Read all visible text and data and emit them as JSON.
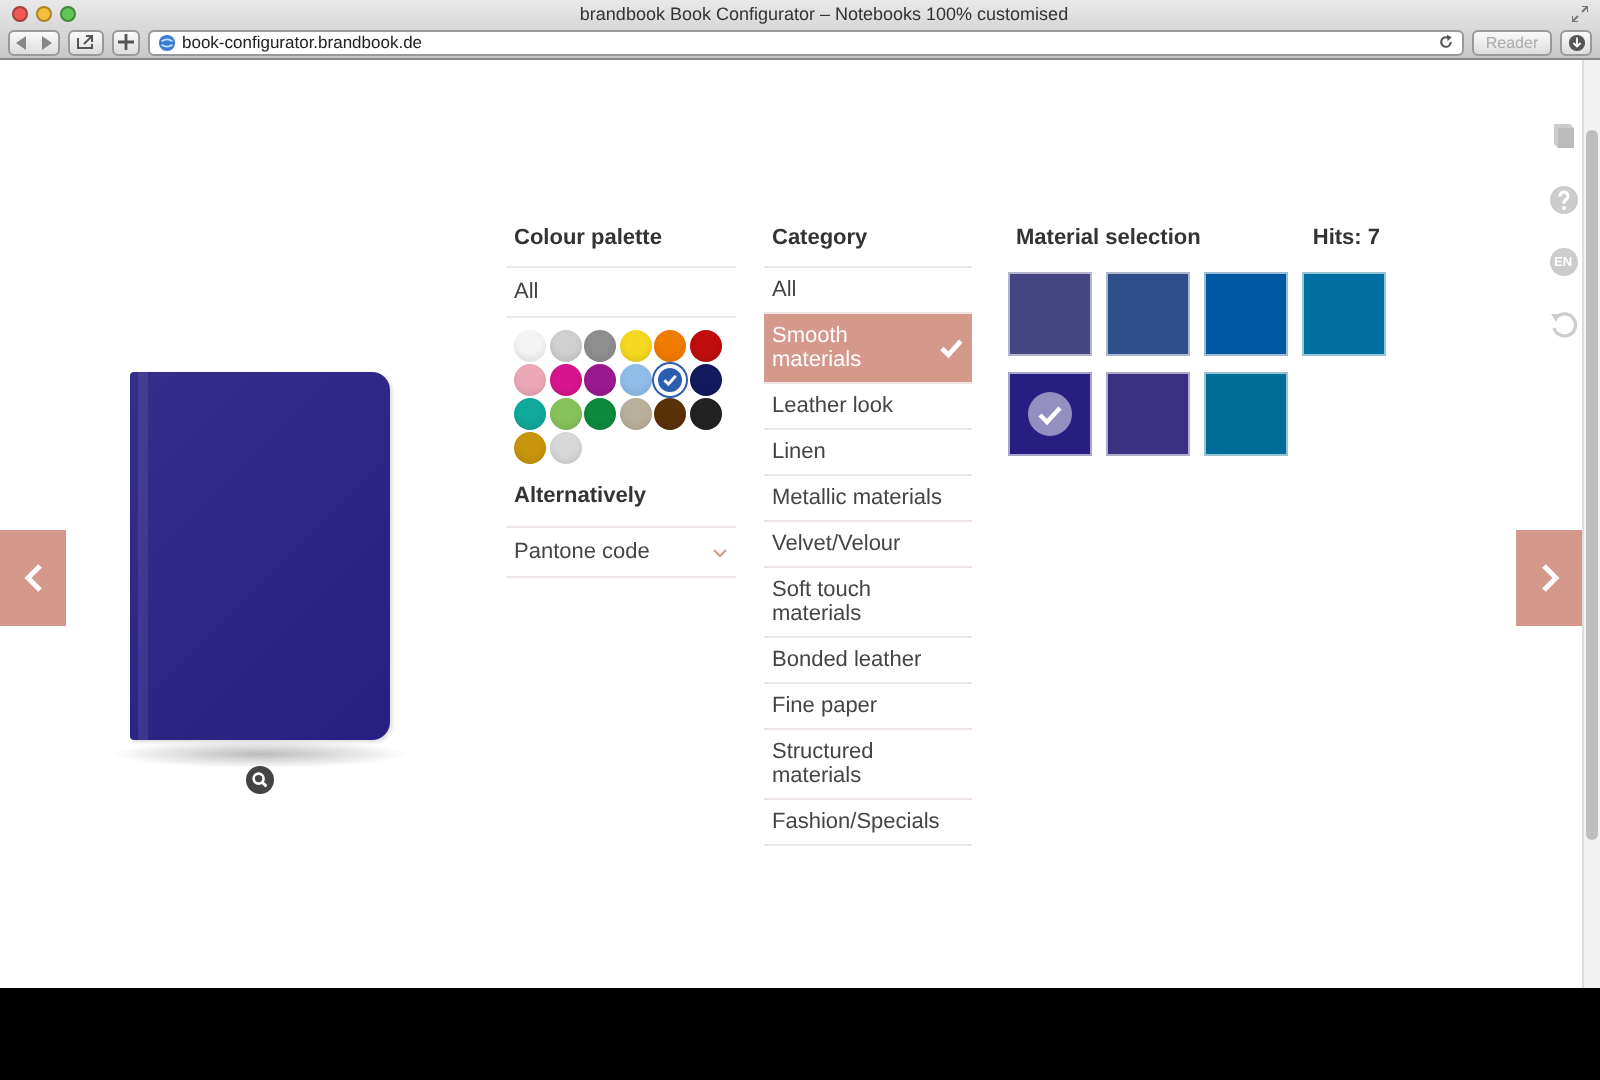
{
  "window": {
    "title": "brandbook Book Configurator – Notebooks 100% customised"
  },
  "toolbar": {
    "url": "book-configurator.brandbook.de",
    "reader_button": "Reader"
  },
  "palette": {
    "title": "Colour palette",
    "all_label": "All",
    "alternative_title": "Alternatively",
    "pantone_select": "Pantone code",
    "swatches": [
      {
        "color": "#f4f4f4",
        "selected": false
      },
      {
        "color": "#cfcfcf",
        "selected": false
      },
      {
        "color": "#8e8e8e",
        "selected": false
      },
      {
        "color": "#f5d820",
        "selected": false
      },
      {
        "color": "#f07c00",
        "selected": false
      },
      {
        "color": "#c00d0d",
        "selected": false
      },
      {
        "color": "#eda8b8",
        "selected": false
      },
      {
        "color": "#d6158e",
        "selected": false
      },
      {
        "color": "#9a1a90",
        "selected": false
      },
      {
        "color": "#8fbde8",
        "selected": false
      },
      {
        "color": "#2b5db0",
        "selected": true
      },
      {
        "color": "#141a5e",
        "selected": false
      },
      {
        "color": "#10a99a",
        "selected": false
      },
      {
        "color": "#86c25a",
        "selected": false
      },
      {
        "color": "#0d8a3c",
        "selected": false
      },
      {
        "color": "#b9b09c",
        "selected": false
      },
      {
        "color": "#5a3208",
        "selected": false
      },
      {
        "color": "#222222",
        "selected": false
      },
      {
        "color": "#c8960c",
        "selected": false
      },
      {
        "color": "#d8d8d8",
        "selected": false
      }
    ]
  },
  "category": {
    "title": "Category",
    "items": [
      {
        "label": "All",
        "selected": false
      },
      {
        "label": "Smooth materials",
        "selected": true
      },
      {
        "label": "Leather look",
        "selected": false
      },
      {
        "label": "Linen",
        "selected": false
      },
      {
        "label": "Metallic materials",
        "selected": false
      },
      {
        "label": "Velvet/Velour",
        "selected": false
      },
      {
        "label": "Soft touch materials",
        "selected": false
      },
      {
        "label": "Bonded leather",
        "selected": false
      },
      {
        "label": "Fine paper",
        "selected": false
      },
      {
        "label": "Structured materials",
        "selected": false
      },
      {
        "label": "Fashion/Specials",
        "selected": false
      }
    ]
  },
  "materials": {
    "title": "Material selection",
    "hits": "Hits: 7",
    "swatches": [
      {
        "color": "#454681",
        "selected": false
      },
      {
        "color": "#2f4f8a",
        "selected": false
      },
      {
        "color": "#0058a3",
        "selected": false
      },
      {
        "color": "#006ea0",
        "selected": false
      },
      {
        "color": "#281e82",
        "selected": true
      },
      {
        "color": "#3b3183",
        "selected": false
      },
      {
        "color": "#006c98",
        "selected": false
      }
    ]
  },
  "side_menu": {
    "language": "EN"
  }
}
